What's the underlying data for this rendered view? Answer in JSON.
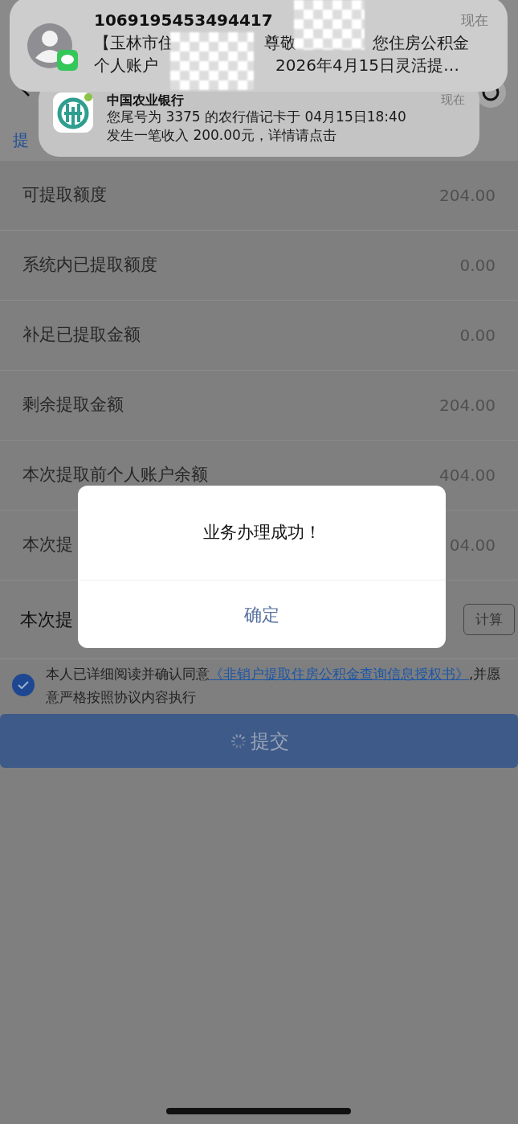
{
  "notifications": [
    {
      "kind": "sms",
      "sender": "1069195453494417",
      "time": "现在",
      "lines": [
        [
          "【玉林市住",
          "尊敬",
          "您住房公积金"
        ],
        [
          "个人账户",
          "2026年4月15日灵活提…"
        ]
      ]
    },
    {
      "kind": "bank",
      "sender": "中国农业银行",
      "time": "现在",
      "lines": [
        [
          "您尾号为 3375 的农行借记卡于 04月15日18:40"
        ],
        [
          "发生一笔收入 200.00元，详情请点击"
        ]
      ]
    }
  ],
  "page": {
    "section_title": "提",
    "rows": [
      {
        "label": "可提取额度",
        "value": "204.00"
      },
      {
        "label": "系统内已提取额度",
        "value": "0.00"
      },
      {
        "label": "补足已提取金额",
        "value": "0.00"
      },
      {
        "label": "剩余提取金额",
        "value": "204.00"
      },
      {
        "label": "本次提取前个人账户余额",
        "value": "404.00"
      },
      {
        "label": "本次提",
        "value": "04.00"
      }
    ],
    "calc_row": {
      "label": "本次提",
      "button": "计算"
    },
    "agreement": {
      "checked": true,
      "text": "本人已详细阅读并确认同意",
      "link": "《非销户提取住房公积金查询信息授权书》",
      "suffix": ",并愿意严格按照协议内容执行"
    },
    "submit": {
      "label": "提交",
      "loading": true
    }
  },
  "dialog": {
    "message": "业务办理成功！",
    "button": "确定"
  }
}
